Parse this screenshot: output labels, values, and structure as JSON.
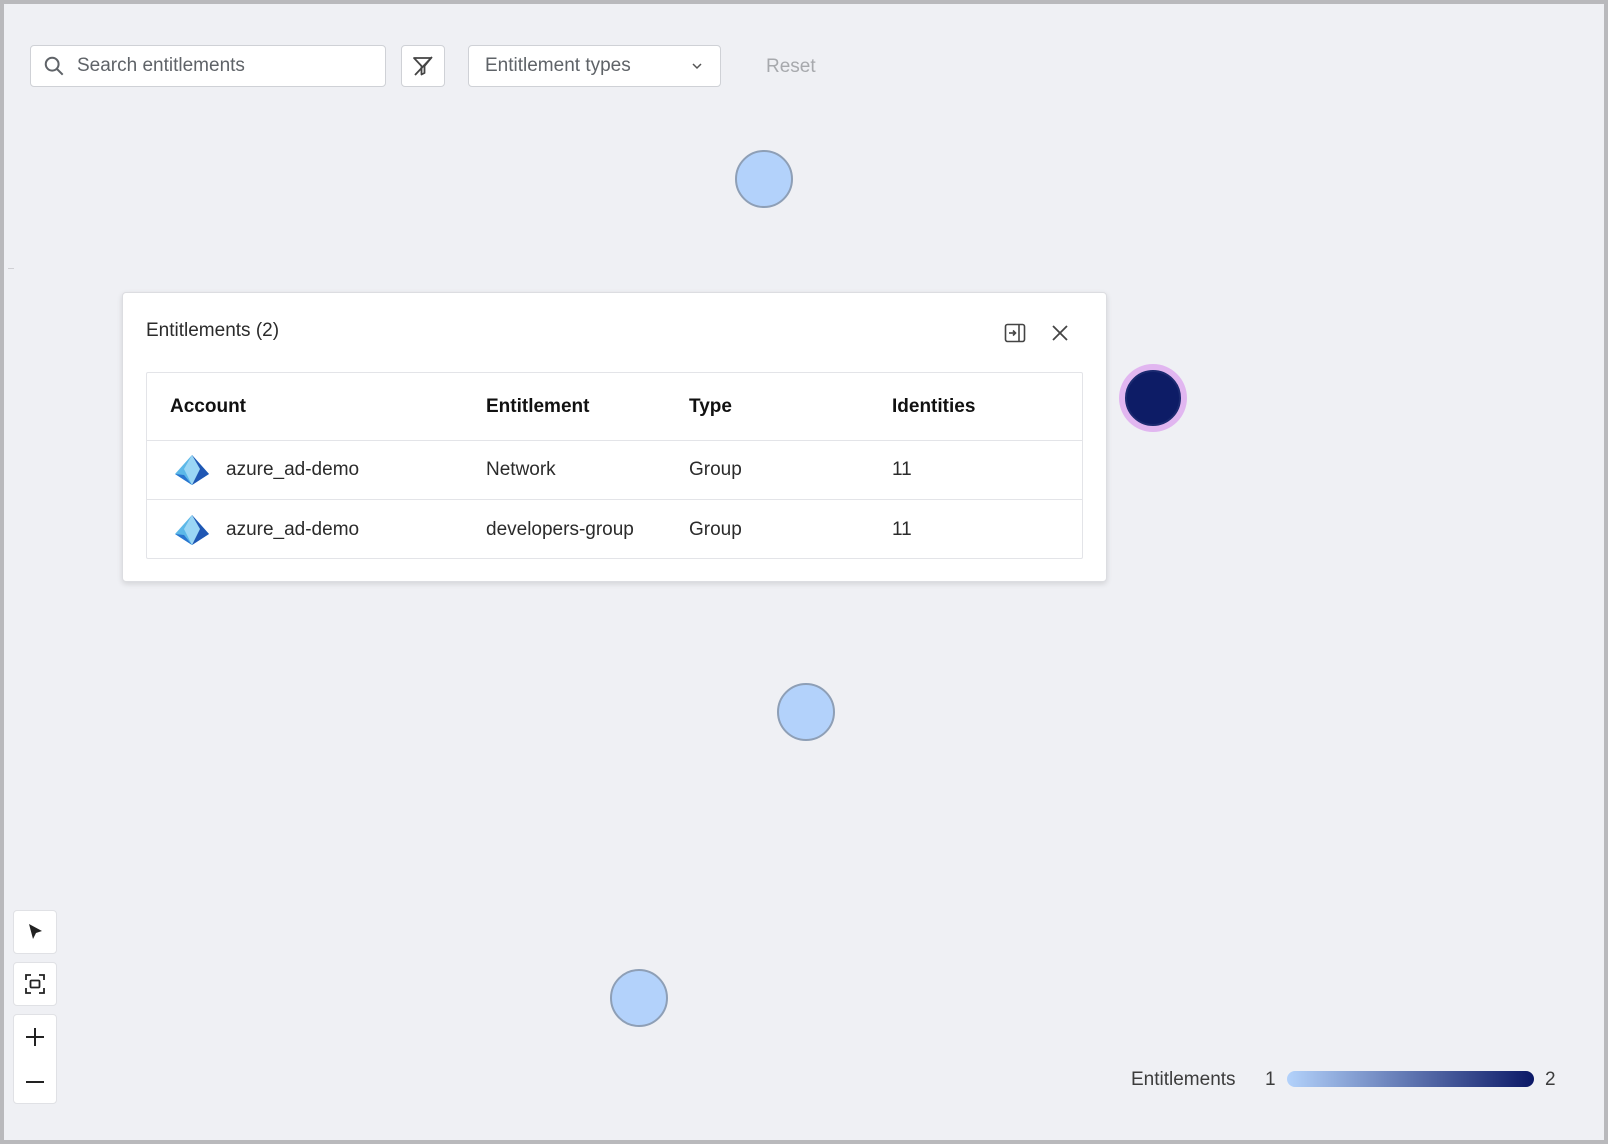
{
  "toolbar": {
    "search_placeholder": "Search entitlements",
    "search_icon": "search-icon",
    "filter_icon": "filter-clear-icon",
    "types_label": "Entitlement types",
    "types_icon": "chevron-down-icon",
    "reset_label": "Reset"
  },
  "graph": {
    "nodes": [
      {
        "shade": "light"
      },
      {
        "shade": "dark",
        "selected": true
      },
      {
        "shade": "light"
      },
      {
        "shade": "light"
      }
    ]
  },
  "panel": {
    "title": "Entitlements (2)",
    "dock_icon": "dock-panel-icon",
    "close_icon": "close-icon",
    "columns": [
      "Account",
      "Entitlement",
      "Type",
      "Identities"
    ],
    "rows": [
      {
        "account": "azure_ad-demo",
        "account_icon": "azure-ad-icon",
        "entitlement": "Network",
        "type": "Group",
        "identities": "11"
      },
      {
        "account": "azure_ad-demo",
        "account_icon": "azure-ad-icon",
        "entitlement": "developers-group",
        "type": "Group",
        "identities": "11"
      }
    ]
  },
  "tools": {
    "select_icon": "pointer-icon",
    "fit_icon": "fit-view-icon",
    "zoom_in_icon": "plus-icon",
    "zoom_out_icon": "minus-icon"
  },
  "legend": {
    "label": "Entitlements",
    "min": "1",
    "max": "2",
    "colors": {
      "low": "#b3d2fb",
      "high": "#0b1866"
    }
  }
}
